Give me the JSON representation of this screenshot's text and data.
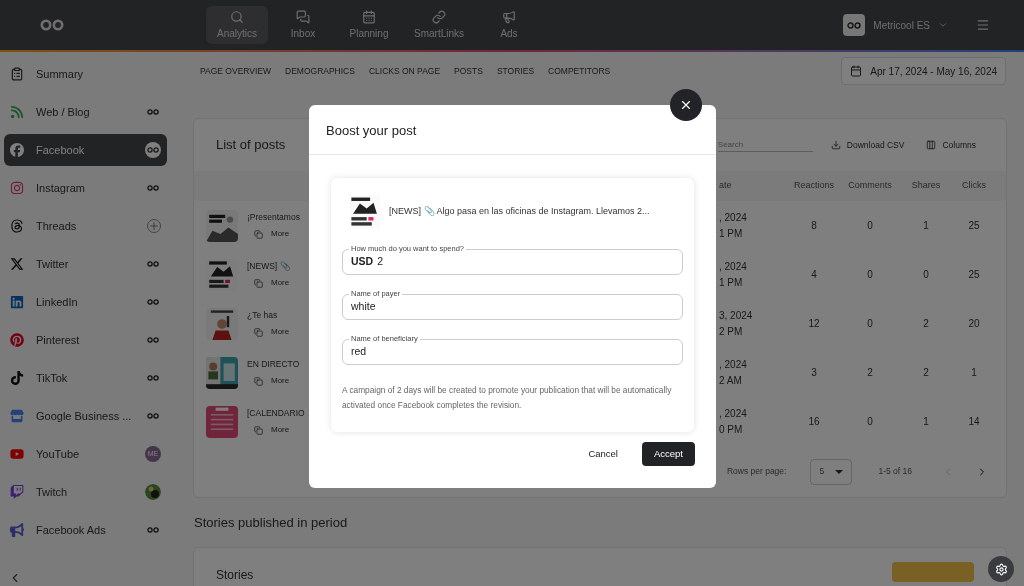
{
  "topbar": {
    "nav": [
      {
        "label": "Analytics",
        "selected": true
      },
      {
        "label": "Inbox",
        "selected": false
      },
      {
        "label": "Planning",
        "selected": false
      },
      {
        "label": "SmartLinks",
        "selected": false
      },
      {
        "label": "Ads",
        "selected": false
      }
    ],
    "account": "Metricool ES"
  },
  "sidebar": {
    "items": [
      {
        "label": "Summary",
        "selected": false
      },
      {
        "label": "Web / Blog",
        "selected": false,
        "kind": "connected"
      },
      {
        "label": "Facebook",
        "selected": true,
        "kind": "connected"
      },
      {
        "label": "Instagram",
        "selected": false,
        "kind": "connected"
      },
      {
        "label": "Threads",
        "selected": false,
        "kind": "add"
      },
      {
        "label": "Twitter",
        "selected": false,
        "kind": "connected"
      },
      {
        "label": "LinkedIn",
        "selected": false,
        "kind": "connected"
      },
      {
        "label": "Pinterest",
        "selected": false,
        "kind": "connected"
      },
      {
        "label": "TikTok",
        "selected": false,
        "kind": "connected"
      },
      {
        "label": "Google Business ...",
        "selected": false,
        "kind": "connected"
      },
      {
        "label": "YouTube",
        "selected": false,
        "kind": "initials",
        "initials": "ME"
      },
      {
        "label": "Twitch",
        "selected": false
      },
      {
        "label": "Facebook Ads",
        "selected": false,
        "kind": "connected"
      }
    ]
  },
  "subtabs": [
    "PAGE OVERVIEW",
    "DEMOGRAPHICS",
    "CLICKS ON PAGE",
    "POSTS",
    "STORIES",
    "COMPETITORS"
  ],
  "date_range": "Apr 17, 2024 - May 16, 2024",
  "posts_card": {
    "title": "List of posts",
    "search_placeholder": "Search",
    "actions": [
      "Download CSV",
      "Columns"
    ],
    "columns": [
      "ate",
      "Reactions",
      "Comments",
      "Shares",
      "Clicks"
    ],
    "rows": [
      {
        "text": "¡Presentamos",
        "more": "More",
        "date": [
          ", 2024",
          "1 PM"
        ],
        "values": [
          "8",
          "0",
          "1",
          "25"
        ]
      },
      {
        "text": "[NEWS] 📎",
        "more": "More",
        "date": [
          ", 2024",
          "1 PM"
        ],
        "values": [
          "4",
          "0",
          "0",
          "25"
        ]
      },
      {
        "text": "¿Te has",
        "more": "More",
        "date": [
          "3, 2024",
          "2 PM"
        ],
        "values": [
          "12",
          "0",
          "2",
          "20"
        ]
      },
      {
        "text": "EN DIRECTO",
        "more": "More",
        "date": [
          ", 2024",
          "2 AM"
        ],
        "values": [
          "3",
          "2",
          "2",
          "1"
        ]
      },
      {
        "text": "[CALENDARIO",
        "more": "More",
        "date": [
          ", 2024",
          "0 PM"
        ],
        "values": [
          "16",
          "0",
          "1",
          "14"
        ]
      }
    ],
    "pagination": {
      "label": "Rows per page:",
      "rows_per_page": "5",
      "range": "1-5 of 16",
      "prev_disabled": true
    }
  },
  "stories": {
    "heading": "Stories published in period",
    "card_title": "Stories"
  },
  "modal": {
    "title": "Boost your post",
    "post_text": "[NEWS] 📎 Algo pasa en las oficinas de Instagram. Llevamos 2...",
    "fields": [
      {
        "label": "How much do you want to spend?",
        "prefix": "USD",
        "value": "2"
      },
      {
        "label": "Name of payer",
        "value": "white"
      },
      {
        "label": "Name of beneficiary",
        "value": "red"
      }
    ],
    "note": "A campaign of 2 days will be created to promote your publication that will be automatically activated once Facebook completes the revision.",
    "buttons": [
      "Cancel",
      "Accept"
    ]
  }
}
